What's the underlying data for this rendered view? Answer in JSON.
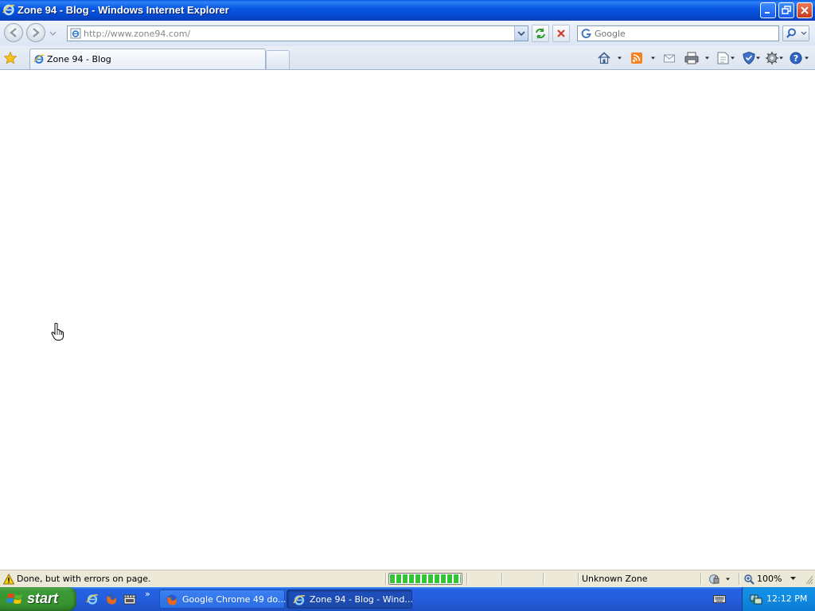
{
  "window": {
    "title": "Zone 94 - Blog - Windows Internet Explorer"
  },
  "address_bar": {
    "url": "http://www.zone94.com/"
  },
  "search": {
    "placeholder": "Google"
  },
  "tabs": [
    {
      "label": "Zone 94 - Blog"
    }
  ],
  "command_bar": {
    "icons": [
      "home-icon",
      "feeds-icon",
      "read-mail-icon",
      "print-icon",
      "page-icon",
      "safety-icon",
      "tools-icon",
      "help-icon"
    ]
  },
  "status_bar": {
    "text": "Done, but with errors on page.",
    "progress": 1.0,
    "zone": "Unknown Zone",
    "zoom": "100%"
  },
  "taskbar": {
    "start_label": "start",
    "quick_launch_more": "»",
    "items": [
      {
        "label": "Google Chrome 49 do...",
        "active": false
      },
      {
        "label": "Zone 94 - Blog - Wind...",
        "active": true
      }
    ],
    "clock": "12:12 PM"
  },
  "colors": {
    "title_bar": "#0858e4",
    "taskbar": "#245edc",
    "start_button": "#3c9a37",
    "progress_fill": "#37c336",
    "status_bar": "#ece9d8"
  }
}
